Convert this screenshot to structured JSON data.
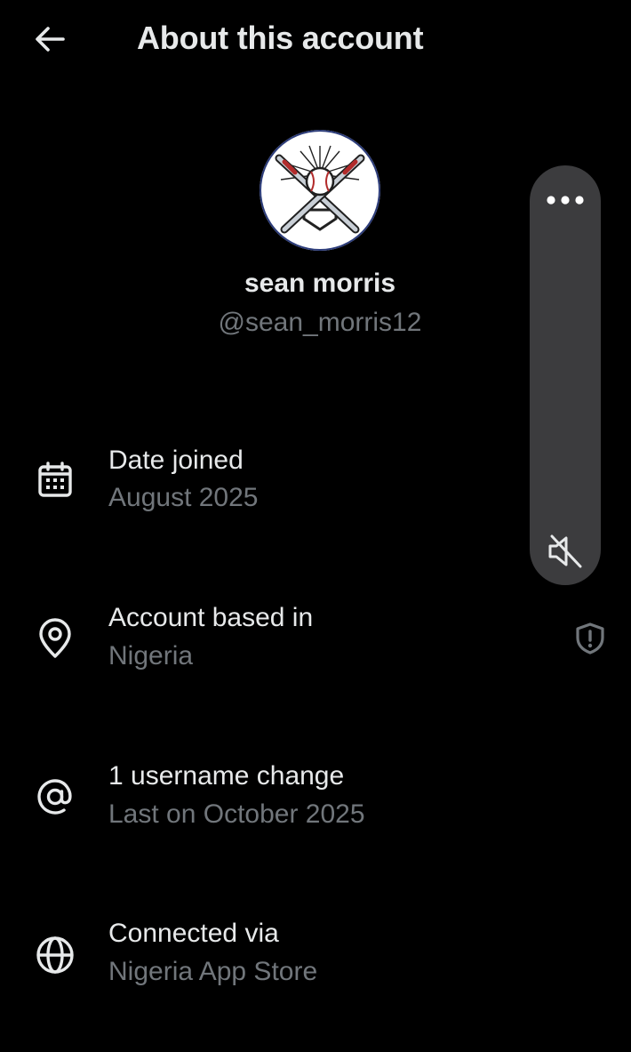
{
  "header": {
    "title": "About this account",
    "back_icon": "arrow-left-icon"
  },
  "profile": {
    "display_name": "sean morris",
    "handle": "@sean_morris12",
    "avatar": "baseball-bats-logo-avatar"
  },
  "rows": [
    {
      "icon": "calendar-icon",
      "title": "Date joined",
      "value": "August 2025"
    },
    {
      "icon": "location-pin-icon",
      "title": "Account based in",
      "value": "Nigeria"
    },
    {
      "icon": "at-sign-icon",
      "title": "1 username change",
      "value": "Last on October 2025"
    },
    {
      "icon": "globe-icon",
      "title": "Connected via",
      "value": "Nigeria App Store"
    }
  ],
  "side_panel": {
    "more_icon": "more-dots-icon",
    "mute_icon": "speaker-muted-icon"
  },
  "shield_icon": "shield-alert-icon",
  "colors": {
    "background": "#000000",
    "primary_text": "#e7e9ea",
    "secondary_text": "#71767b",
    "panel": "#3c3c3e"
  }
}
